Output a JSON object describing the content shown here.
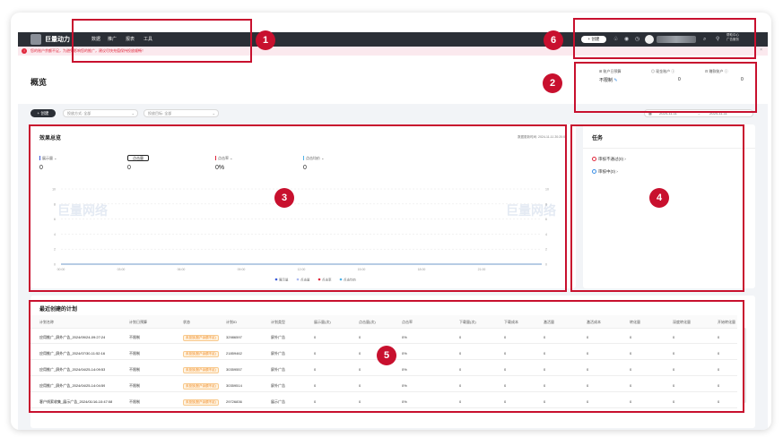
{
  "topnav": {
    "brand": "巨量动力",
    "items": [
      "数据",
      "推广",
      "报表",
      "工具"
    ],
    "create_label": "+ 创建",
    "help_label_1": "帮助中心",
    "help_label_2": "广告服务"
  },
  "notice": {
    "icon": "!",
    "text": "您的账户余额不足，为避免影响您的推广，建议尽快充值保持投放顺畅！",
    "close": "×"
  },
  "header": {
    "title": "概览",
    "stats": [
      {
        "label": "账户日预算",
        "value": "不限制"
      },
      {
        "label": "现金账户",
        "value": "0"
      },
      {
        "label": "赠款账户",
        "value": "0"
      }
    ]
  },
  "filters": {
    "new_label": "+ 创建",
    "select1": "投放方式: 全部",
    "select2": "投放目标: 全部",
    "date_start": "2024-11-11",
    "date_sep": "→",
    "date_end": "2024-11-11"
  },
  "overview": {
    "title": "效果总览",
    "updated": "数据更新时间: 2024-11-11 20:20:00",
    "metrics": [
      {
        "label": "展示量",
        "value": "0",
        "color": "#3a5bd9"
      },
      {
        "label": "点击量",
        "value": "0",
        "color": "#222222"
      },
      {
        "label": "点击率",
        "value": "0%",
        "color": "#e0283c"
      },
      {
        "label": "点击均价",
        "value": "0",
        "color": "#4fb3e8"
      }
    ],
    "watermark": "巨量网络",
    "legend": [
      "展示量",
      "点击量",
      "点击率",
      "点击均价"
    ]
  },
  "chart_data": {
    "type": "line",
    "x": [
      "00:00",
      "03:00",
      "06:00",
      "09:00",
      "12:00",
      "15:00",
      "18:00",
      "21:00"
    ],
    "yticks_left": [
      "0",
      "2",
      "4",
      "6",
      "8",
      "10"
    ],
    "yticks_right": [
      "0",
      "2",
      "4",
      "6",
      "8",
      "10"
    ],
    "ylim": [
      0,
      10
    ],
    "series": [
      {
        "name": "展示量",
        "values": [
          0,
          0,
          0,
          0,
          0,
          0,
          0,
          0
        ],
        "color": "#3a5bd9"
      },
      {
        "name": "点击量",
        "values": [
          0,
          0,
          0,
          0,
          0,
          0,
          0,
          0
        ],
        "color": "#aab8f0"
      },
      {
        "name": "点击率",
        "values": [
          0,
          0,
          0,
          0,
          0,
          0,
          0,
          0
        ],
        "color": "#e0283c"
      },
      {
        "name": "点击均价",
        "values": [
          0,
          0,
          0,
          0,
          0,
          0,
          0,
          0
        ],
        "color": "#4fb3e8"
      }
    ],
    "legend_position": "bottom"
  },
  "tasks": {
    "title": "任务",
    "items": [
      {
        "label": "审核不通过(0)",
        "color": "#e0283c"
      },
      {
        "label": "审核中(0)",
        "color": "#3a8ee6"
      }
    ]
  },
  "plans": {
    "title": "最近创建的计划",
    "columns": [
      "计划名称",
      "计划日预算",
      "状态",
      "计划ID",
      "计划类型",
      "展示量(次)",
      "点击量(次)",
      "点击率",
      "下载量(次)",
      "下载成本",
      "激活量",
      "激活成本",
      "转化量",
      "深度转化量",
      "开始转化量"
    ],
    "rows": [
      [
        "应用推广_屏外广告_2024/09/24-09:27:24",
        "不限制",
        "未投放(账户余额不足)",
        "32986597",
        "屏外广告",
        "0",
        "0",
        "0%",
        "0",
        "0",
        "0",
        "0",
        "0",
        "0",
        "0"
      ],
      [
        "应用推广_屏外广告_2024/07/30-11:52:16",
        "不限制",
        "未投放(账户余额不足)",
        "21859462",
        "屏外广告",
        "0",
        "0",
        "0%",
        "0",
        "0",
        "0",
        "0",
        "0",
        "0",
        "0"
      ],
      [
        "应用推广_屏外广告_2024/04/25-14:09:53",
        "不限制",
        "未投放(账户余额不足)",
        "30359557",
        "屏外广告",
        "0",
        "0",
        "0%",
        "0",
        "0",
        "0",
        "0",
        "0",
        "0",
        "0"
      ],
      [
        "应用推广_屏外广告_2024/04/25-14:04:59",
        "不限制",
        "未投放(账户余额不足)",
        "30359514",
        "屏外广告",
        "0",
        "0",
        "0%",
        "0",
        "0",
        "0",
        "0",
        "0",
        "0",
        "0"
      ],
      [
        "客户线索收集_展示广告_2024/01/16-10:47:08",
        "不限制",
        "未投放(账户余额不足)",
        "29726836",
        "展示广告",
        "0",
        "0",
        "0%",
        "0",
        "0",
        "0",
        "0",
        "0",
        "0",
        "0"
      ]
    ]
  },
  "annotations": [
    "1",
    "2",
    "3",
    "4",
    "5",
    "6"
  ]
}
